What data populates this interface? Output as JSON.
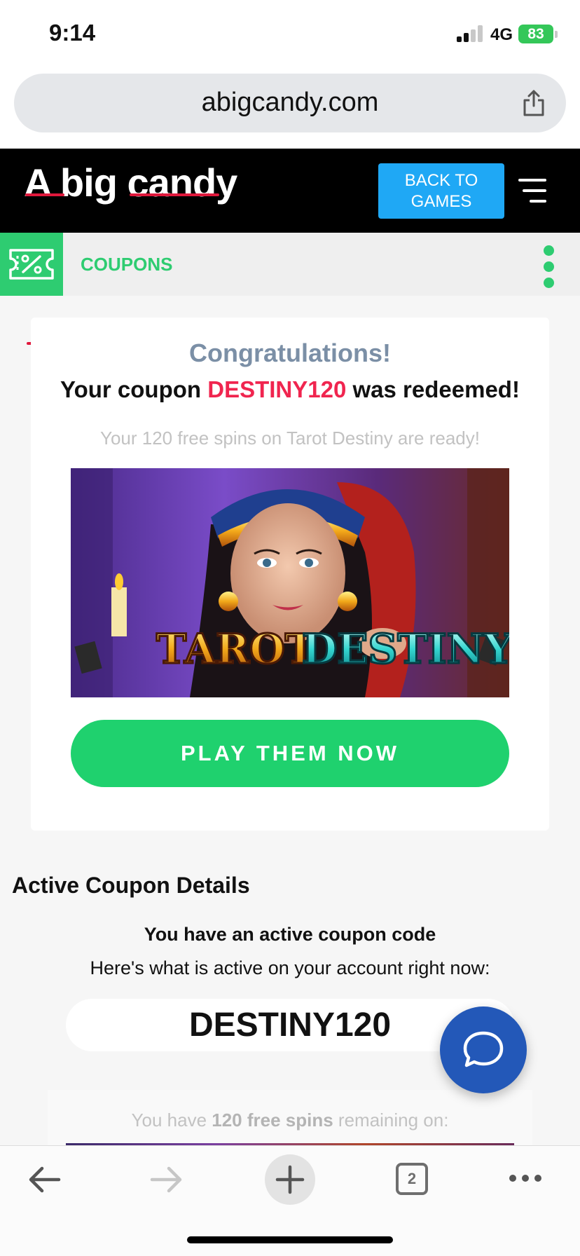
{
  "status_bar": {
    "time": "9:14",
    "network": "4G",
    "battery": "83"
  },
  "browser": {
    "url": "abigcandy.com",
    "tab_count": "2"
  },
  "site_header": {
    "logo_text": "A big candy",
    "back_button_line1": "BACK TO",
    "back_button_line2": "GAMES"
  },
  "coupons_bar": {
    "label": "COUPONS"
  },
  "redeem_card": {
    "title": "Congratulations!",
    "message_prefix": "Your coupon ",
    "coupon_code": "DESTINY120",
    "message_suffix": " was redeemed!",
    "subtitle": "Your 120 free spins on Tarot Destiny are ready!",
    "game_title_word1": "TAROT",
    "game_title_word2": "DESTINY",
    "play_button": "PLAY THEM NOW"
  },
  "active_coupon": {
    "heading": "Active Coupon Details",
    "subheading": "You have an active coupon code",
    "description": "Here's what is active on your account right now:",
    "code": "DESTINY120",
    "remaining_prefix": "You have ",
    "remaining_bold": "120 free spins",
    "remaining_suffix": " remaining on:"
  },
  "colors": {
    "accent_green": "#2ecc71",
    "button_blue": "#1fa8f5",
    "coupon_red": "#f0254f",
    "chat_blue": "#2358b8"
  },
  "icons": [
    "share-icon",
    "menu-icon",
    "coupon-percent-icon",
    "kebab-menu-icon",
    "chat-icon",
    "back-arrow-icon",
    "forward-arrow-icon",
    "plus-icon",
    "tabs-icon",
    "more-icon"
  ]
}
